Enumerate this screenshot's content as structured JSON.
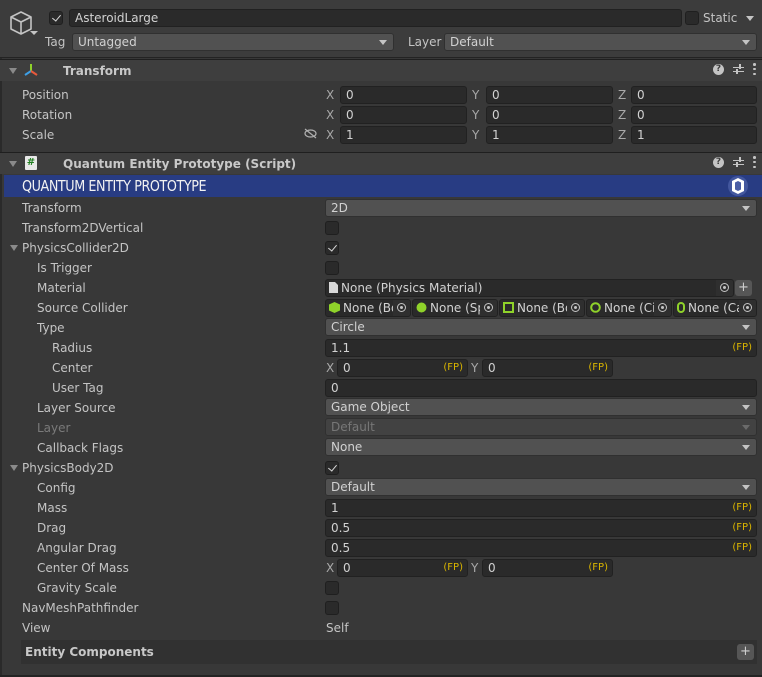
{
  "header": {
    "object_name": "AsteroidLarge",
    "active": true,
    "static_label": "Static",
    "static": false,
    "tag_label": "Tag",
    "tag_value": "Untagged",
    "layer_label": "Layer",
    "layer_value": "Default"
  },
  "transform": {
    "title": "Transform",
    "rows": [
      {
        "label": "Position",
        "x": "0",
        "y": "0",
        "z": "0"
      },
      {
        "label": "Rotation",
        "x": "0",
        "y": "0",
        "z": "0"
      },
      {
        "label": "Scale",
        "x": "1",
        "y": "1",
        "z": "1"
      }
    ],
    "axes": {
      "x": "X",
      "y": "Y",
      "z": "Z"
    }
  },
  "script": {
    "title": "Quantum Entity Prototype (Script)",
    "banner": "QUANTUM ENTITY PROTOTYPE",
    "banner_color": "#283c83",
    "fp_suffix": "(FP)",
    "fields": {
      "transform": {
        "label": "Transform",
        "value": "2D"
      },
      "transform2d_vertical": {
        "label": "Transform2DVertical",
        "checked": false
      },
      "physics_collider": {
        "label": "PhysicsCollider2D",
        "checked": true
      },
      "is_trigger": {
        "label": "Is Trigger",
        "checked": false
      },
      "material": {
        "label": "Material",
        "value": "None (Physics Material)"
      },
      "source_collider": {
        "label": "Source Collider",
        "slots": [
          "None (Bo",
          "None (Sp",
          "None (Bo",
          "None (Ci",
          "None (Ca"
        ]
      },
      "type": {
        "label": "Type",
        "value": "Circle"
      },
      "radius": {
        "label": "Radius",
        "value": "1.1"
      },
      "center": {
        "label": "Center",
        "x": "0",
        "y": "0"
      },
      "user_tag": {
        "label": "User Tag",
        "value": "0"
      },
      "layer_source": {
        "label": "Layer Source",
        "value": "Game Object"
      },
      "layer": {
        "label": "Layer",
        "value": "Default"
      },
      "callback_flags": {
        "label": "Callback Flags",
        "value": "None"
      },
      "physics_body": {
        "label": "PhysicsBody2D",
        "checked": true
      },
      "config": {
        "label": "Config",
        "value": "Default"
      },
      "mass": {
        "label": "Mass",
        "value": "1"
      },
      "drag": {
        "label": "Drag",
        "value": "0.5"
      },
      "angular_drag": {
        "label": "Angular Drag",
        "value": "0.5"
      },
      "center_of_mass": {
        "label": "Center Of Mass",
        "x": "0",
        "y": "0"
      },
      "gravity_scale": {
        "label": "Gravity Scale",
        "checked": false
      },
      "navmesh": {
        "label": "NavMeshPathfinder",
        "checked": false
      },
      "view": {
        "label": "View",
        "value": "Self"
      }
    },
    "entity_components": {
      "title": "Entity Components",
      "add_label": "+"
    }
  },
  "colors": {
    "fp_yellow": "#d9b500",
    "collider_green": "#8fd22a"
  }
}
